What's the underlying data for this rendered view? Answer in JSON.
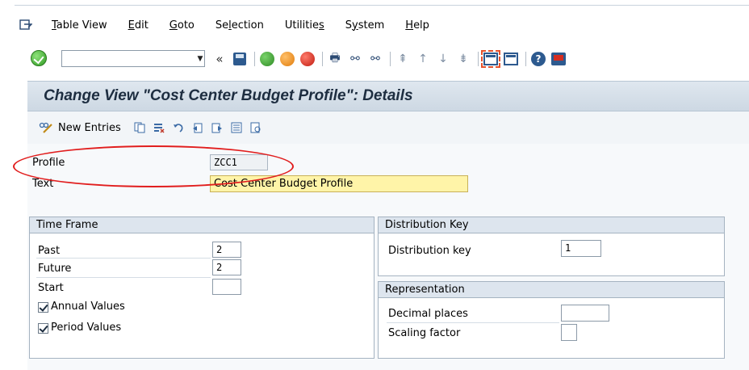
{
  "menu": {
    "items": [
      {
        "label_u": "T",
        "label_rest": "able View"
      },
      {
        "label_u": "E",
        "label_rest": "dit"
      },
      {
        "label_u": "G",
        "label_rest": "oto"
      },
      {
        "label_pre": "Se",
        "label_u": "l",
        "label_rest": "ection"
      },
      {
        "label_pre": "Utilitie",
        "label_u": "s",
        "label_rest": ""
      },
      {
        "label_pre": "S",
        "label_u": "y",
        "label_rest": "stem"
      },
      {
        "label_u": "H",
        "label_rest": "elp"
      }
    ]
  },
  "toolbar": {
    "command_value": "",
    "back_glyph": "«"
  },
  "title": "Change View \"Cost Center Budget Profile\": Details",
  "app_toolbar": {
    "new_entries": "New Entries"
  },
  "header_fields": {
    "profile_label": "Profile",
    "profile_value": "ZCC1",
    "text_label": "Text",
    "text_value": "Cost Center Budget Profile"
  },
  "time_frame": {
    "title": "Time Frame",
    "past_label": "Past",
    "past_value": "2",
    "future_label": "Future",
    "future_value": "2",
    "start_label": "Start",
    "start_value": "",
    "annual_label": "Annual Values",
    "annual_checked": true,
    "period_label": "Period Values",
    "period_checked": true
  },
  "distribution": {
    "title": "Distribution Key",
    "key_label": "Distribution key",
    "key_value": "1"
  },
  "representation": {
    "title": "Representation",
    "decimal_label": "Decimal places",
    "decimal_value": "",
    "scaling_label": "Scaling factor",
    "scaling_value": ""
  },
  "colors": {
    "highlight_ellipse": "#e11e1e",
    "title_bg": "#cdd8e3",
    "required_field": "#fff4a8"
  }
}
